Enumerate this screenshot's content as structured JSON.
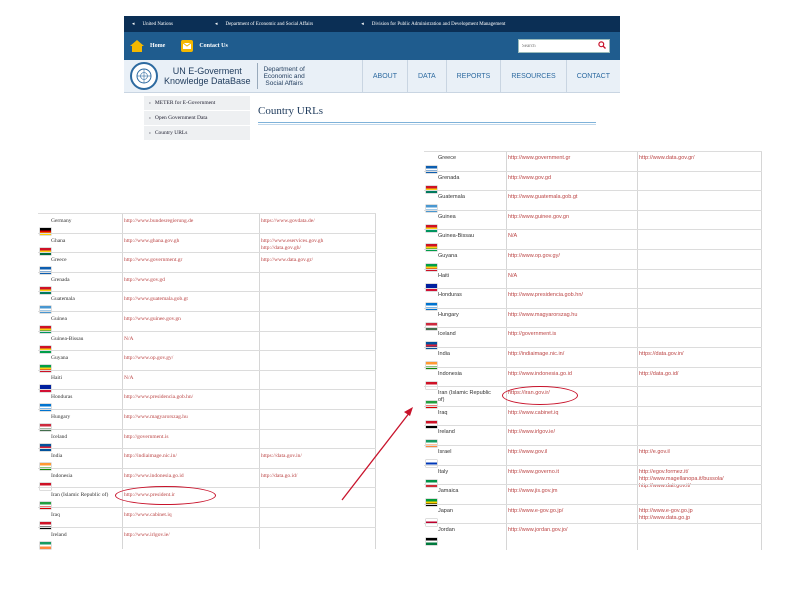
{
  "header": {
    "breadcrumbs": [
      "United Nations",
      "Department of Economic and Social Affairs",
      "Division for Public Administration and Development Management"
    ],
    "nav": {
      "home_label": "Home",
      "contact_label": "Contact Us"
    },
    "search": {
      "placeholder": "Search"
    },
    "brand": {
      "title_line1": "UN E-Goverment",
      "title_line2": "Knowledge DataBase",
      "dept_line1": "Department of",
      "dept_line2": "Economic and",
      "dept_line3": "Social Affairs"
    },
    "menu": [
      "ABOUT",
      "DATA",
      "REPORTS",
      "RESOURCES",
      "CONTACT"
    ]
  },
  "sidebar": {
    "items": [
      "METER for E-Government",
      "Open Government Data",
      "Country URLs"
    ]
  },
  "page_title": "Country URLs",
  "left_table": {
    "rows": [
      {
        "country": "Germany",
        "url1": "http://www.bundesregierung.de",
        "url2": "https://www.govdata.de/",
        "flag": [
          "#000000",
          "#dd0000",
          "#ffce00"
        ]
      },
      {
        "country": "Ghana",
        "url1": "http://www.ghana.gov.gh",
        "url2": "http://www.eservices.gov.gh",
        "url2b": "http://data.gov.gh/",
        "flag": [
          "#ce1126",
          "#fcd116",
          "#006b3f"
        ]
      },
      {
        "country": "Greece",
        "url1": "http://www.government.gr",
        "url2": "http://www.data.gov.gr/",
        "flag": [
          "#0d5eaf",
          "#ffffff",
          "#0d5eaf"
        ]
      },
      {
        "country": "Grenada",
        "url1": "http://www.gov.gd",
        "url2": "",
        "flag": [
          "#ce1126",
          "#fcd116",
          "#007a5e"
        ]
      },
      {
        "country": "Guatemala",
        "url1": "http://www.guatemala.gob.gt",
        "url2": "",
        "flag": [
          "#4997d0",
          "#ffffff",
          "#4997d0"
        ]
      },
      {
        "country": "Guinea",
        "url1": "http://www.guinee.gov.gn",
        "url2": "",
        "flag": [
          "#ce1126",
          "#fcd116",
          "#009460"
        ]
      },
      {
        "country": "Guinea-Bissau",
        "url1": "N/A",
        "url2": "",
        "flag": [
          "#ce1126",
          "#fcd116",
          "#009e49"
        ]
      },
      {
        "country": "Guyana",
        "url1": "http://www.op.gov.gy/",
        "url2": "",
        "flag": [
          "#009e49",
          "#fcd116",
          "#ce1126"
        ]
      },
      {
        "country": "Haiti",
        "url1": "N/A",
        "url2": "",
        "flag": [
          "#00209f",
          "#00209f",
          "#d21034"
        ]
      },
      {
        "country": "Honduras",
        "url1": "http://www.presidencia.gob.hn/",
        "url2": "",
        "flag": [
          "#0073cf",
          "#ffffff",
          "#0073cf"
        ]
      },
      {
        "country": "Hungary",
        "url1": "http://www.magyarorszag.hu",
        "url2": "",
        "flag": [
          "#cd2a3e",
          "#ffffff",
          "#436f4d"
        ]
      },
      {
        "country": "Iceland",
        "url1": "http://government.is",
        "url2": "",
        "flag": [
          "#02529c",
          "#dc1e35",
          "#02529c"
        ]
      },
      {
        "country": "India",
        "url1": "http://indiaimage.nic.in/",
        "url2": "https://data.gov.in/",
        "flag": [
          "#ff9933",
          "#ffffff",
          "#138808"
        ]
      },
      {
        "country": "Indonesia",
        "url1": "http://www.indonesia.go.id",
        "url2": "http://data.go.id/",
        "flag": [
          "#ce1126",
          "#ffffff",
          "#ffffff"
        ]
      },
      {
        "country": "Iran (Islamic Republic of)",
        "url1": "http://www.president.ir",
        "url2": "",
        "flag": [
          "#239f40",
          "#ffffff",
          "#da0000"
        ]
      },
      {
        "country": "Iraq",
        "url1": "http://www.cabinet.iq",
        "url2": "",
        "flag": [
          "#ce1126",
          "#ffffff",
          "#000000"
        ]
      },
      {
        "country": "Ireland",
        "url1": "http://www.irlgov.ie/",
        "url2": "",
        "flag": [
          "#169b62",
          "#ffffff",
          "#ff883e"
        ]
      }
    ]
  },
  "right_table": {
    "rows": [
      {
        "country": "Greece",
        "url1": "http://www.government.gr",
        "url2": "http://www.data.gov.gr/",
        "flag": [
          "#0d5eaf",
          "#ffffff",
          "#0d5eaf"
        ]
      },
      {
        "country": "Grenada",
        "url1": "http://www.gov.gd",
        "url2": "",
        "flag": [
          "#ce1126",
          "#fcd116",
          "#007a5e"
        ]
      },
      {
        "country": "Guatemala",
        "url1": "http://www.guatemala.gob.gt",
        "url2": "",
        "flag": [
          "#4997d0",
          "#ffffff",
          "#4997d0"
        ]
      },
      {
        "country": "Guinea",
        "url1": "http://www.guinee.gov.gn",
        "url2": "",
        "flag": [
          "#ce1126",
          "#fcd116",
          "#009460"
        ]
      },
      {
        "country": "Guinea-Bissau",
        "url1": "N/A",
        "url2": "",
        "flag": [
          "#ce1126",
          "#fcd116",
          "#009e49"
        ]
      },
      {
        "country": "Guyana",
        "url1": "http://www.op.gov.gy/",
        "url2": "",
        "flag": [
          "#009e49",
          "#fcd116",
          "#ce1126"
        ]
      },
      {
        "country": "Haiti",
        "url1": "N/A",
        "url2": "",
        "flag": [
          "#00209f",
          "#00209f",
          "#d21034"
        ]
      },
      {
        "country": "Honduras",
        "url1": "http://www.presidencia.gob.hn/",
        "url2": "",
        "flag": [
          "#0073cf",
          "#ffffff",
          "#0073cf"
        ]
      },
      {
        "country": "Hungary",
        "url1": "http://www.magyarorszag.hu",
        "url2": "",
        "flag": [
          "#cd2a3e",
          "#ffffff",
          "#436f4d"
        ]
      },
      {
        "country": "Iceland",
        "url1": "http://government.is",
        "url2": "",
        "flag": [
          "#02529c",
          "#dc1e35",
          "#02529c"
        ]
      },
      {
        "country": "India",
        "url1": "http://indiaimage.nic.in/",
        "url2": "https://data.gov.in/",
        "flag": [
          "#ff9933",
          "#ffffff",
          "#138808"
        ]
      },
      {
        "country": "Indonesia",
        "url1": "http://www.indonesia.go.id",
        "url2": "http://data.go.id/",
        "flag": [
          "#ce1126",
          "#ffffff",
          "#ffffff"
        ]
      },
      {
        "country": "Iran (Islamic Republic",
        "country_line2": "of)",
        "url1": "https://iran.gov.ir/",
        "url2": "",
        "flag": [
          "#239f40",
          "#ffffff",
          "#da0000"
        ]
      },
      {
        "country": "Iraq",
        "url1": "http://www.cabinet.iq",
        "url2": "",
        "flag": [
          "#ce1126",
          "#ffffff",
          "#000000"
        ]
      },
      {
        "country": "Ireland",
        "url1": "http://www.irlgov.ie/",
        "url2": "",
        "flag": [
          "#169b62",
          "#ffffff",
          "#ff883e"
        ]
      },
      {
        "country": "Israel",
        "url1": "http://www.gov.il",
        "url2": "http://e.gov.il",
        "flag": [
          "#ffffff",
          "#0038b8",
          "#ffffff"
        ]
      },
      {
        "country": "Italy",
        "url1": "http://www.governo.it",
        "url2": "http://egov.formez.it/",
        "url2b": "http://www.magellanopa.it/bussola/",
        "url2c": "http://www.dati.gov.it/",
        "flag": [
          "#009246",
          "#ffffff",
          "#ce2b37"
        ]
      },
      {
        "country": "Jamaica",
        "url1": "http://www.jis.gov.jm",
        "url2": "",
        "flag": [
          "#009b3a",
          "#fed100",
          "#000000"
        ]
      },
      {
        "country": "Japan",
        "url1": "http://www.e-gov.go.jp/",
        "url2": "http://www.e-gov.go.jp",
        "url2b": "http://www.data.go.jp",
        "flag": [
          "#ffffff",
          "#bc002d",
          "#ffffff"
        ]
      },
      {
        "country": "Jordan",
        "url1": "http://www.jordan.gov.jo/",
        "url2": "",
        "flag": [
          "#000000",
          "#ffffff",
          "#007a3d"
        ]
      }
    ]
  },
  "colors": {
    "un_bar": "#0b2f55",
    "nav_bar": "#1f5c8e",
    "highlight": "#c8132b",
    "url_text": "#b44"
  }
}
